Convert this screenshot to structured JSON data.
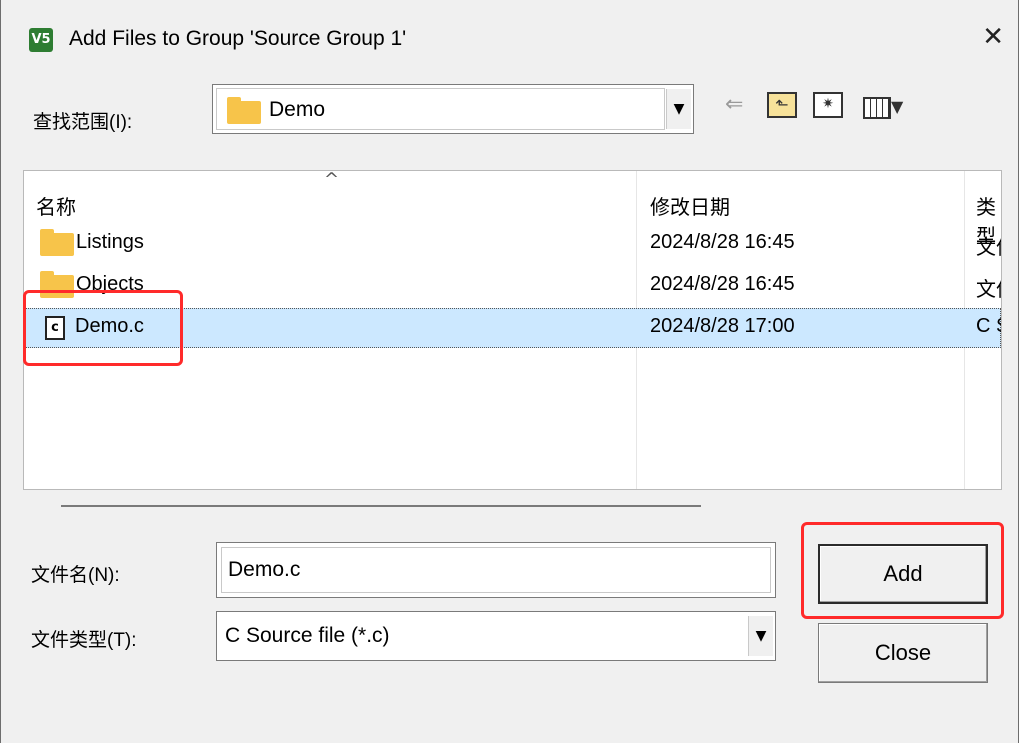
{
  "window": {
    "title": "Add Files to Group 'Source Group 1'",
    "app_icon_text": "V5",
    "close_glyph": "✕"
  },
  "lookin": {
    "label": "查找范围(I):",
    "value": "Demo"
  },
  "toolbar": {
    "back": "back-arrow-icon",
    "up": "up-folder-icon",
    "new_folder": "new-folder-icon",
    "view": "view-menu-icon"
  },
  "list": {
    "columns": [
      "名称",
      "修改日期",
      "类型"
    ],
    "rows": [
      {
        "name": "Listings",
        "modified": "2024/8/28 16:45",
        "type": "文件夹",
        "icon": "folder-icon"
      },
      {
        "name": "Objects",
        "modified": "2024/8/28 16:45",
        "type": "文件夹",
        "icon": "folder-icon"
      },
      {
        "name": "Demo.c",
        "modified": "2024/8/28 17:00",
        "type": "C Source file",
        "icon": "c-file-icon",
        "selected": true
      }
    ]
  },
  "filename": {
    "label": "文件名(N):",
    "value": "Demo.c"
  },
  "filetype": {
    "label": "文件类型(T):",
    "value": "C Source file (*.c)"
  },
  "buttons": {
    "add": "Add",
    "close": "Close"
  },
  "colors": {
    "selection": "#cce8ff",
    "highlight": "#ff2a2a",
    "folder": "#f7c44a"
  }
}
